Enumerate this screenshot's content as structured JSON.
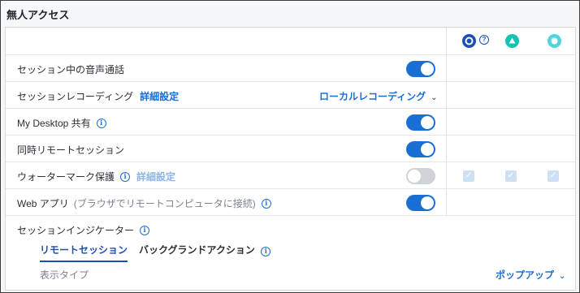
{
  "section": {
    "title": "無人アクセス"
  },
  "platforms": [
    {
      "icon": "windows-gear-icon",
      "color": "#1a4fb8"
    },
    {
      "icon": "help-icon",
      "glyph": "?"
    },
    {
      "icon": "android-triangle-icon",
      "color": "#17c2b0"
    },
    {
      "icon": "other-os-circle-icon",
      "color": "#4fd4e0"
    }
  ],
  "rows": [
    {
      "label": "セッション中の音声通話",
      "toggle": "on"
    },
    {
      "label": "セッションレコーディング",
      "link": "詳細設定",
      "dropdown": "ローカルレコーディング"
    },
    {
      "label": "My Desktop 共有",
      "info": "i",
      "toggle": "on"
    },
    {
      "label": "同時リモートセッション",
      "toggle": "on"
    },
    {
      "label": "ウォーターマーク保護",
      "info": "i",
      "link": "詳細設定",
      "toggle": "off"
    },
    {
      "label": "Web アプリ",
      "extra": "(ブラウザでリモートコンピュータに接続)",
      "info": "i",
      "toggle": "on"
    },
    {
      "label": "セッションインジケーター",
      "info": "i"
    }
  ],
  "subtabs": [
    {
      "label": "リモートセッション",
      "active": true
    },
    {
      "label": "バックグランドアクション",
      "info": "i",
      "active": false
    }
  ],
  "display_type": {
    "label": "表示タイプ",
    "value": "ポップアップ"
  },
  "glyphs": {
    "chevron": "⌄",
    "check": "✓"
  }
}
